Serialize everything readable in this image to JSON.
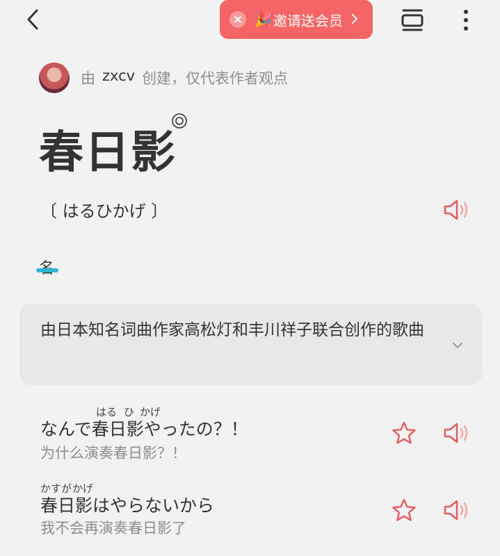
{
  "header": {
    "invite_emoji": "🎉",
    "invite_label": "邀请送会员",
    "back_icon": "chevron-left-icon",
    "fit_icon": "fit-width-icon",
    "more_icon": "more-vertical-icon"
  },
  "creator": {
    "prefix": "由",
    "name": "zxcv",
    "suffix": "创建，仅代表作者观点"
  },
  "entry": {
    "word": "春日影",
    "reading": "〔 はるひかげ 〕",
    "part_of_speech": "名",
    "definition": "由日本知名词曲作家高松灯和丰川祥子联合创作的歌曲"
  },
  "examples": [
    {
      "ruby": [
        "はる",
        "ひ",
        "かげ"
      ],
      "japanese": "なんで春日影やったの？！",
      "chinese": "为什么演奏春日影？！"
    },
    {
      "ruby": [
        "かすが",
        "かげ"
      ],
      "japanese": "春日影はやらないから",
      "chinese": "我不会再演奏春日影了"
    }
  ],
  "colors": {
    "background": "#f2f2f2",
    "accent_red": "#f56466",
    "underline_blue": "#2fb7d6",
    "card": "#e8e8e8"
  }
}
